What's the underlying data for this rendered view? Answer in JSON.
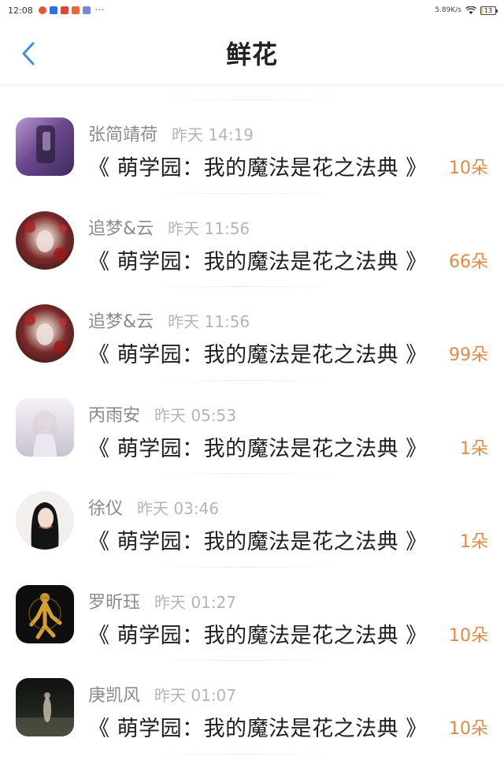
{
  "status_bar": {
    "time": "12:08",
    "dots": "···",
    "net_speed": "5.89K/s",
    "battery": "13",
    "notification_colors": [
      "#e8572f",
      "#2f6fe8",
      "#e2403a",
      "#e86a3a",
      "#7a88d8"
    ]
  },
  "header": {
    "title": "鲜花",
    "back_icon": "chevron-left-icon",
    "accent_color": "#3d8fe0"
  },
  "items": [
    {
      "name": "张简靖荷",
      "time": "昨天 14:19",
      "book": "《 萌学园：我的魔法是花之法典 》",
      "count": "10朵",
      "avatar_shape": "square",
      "avatar_bg": "#7a5a9e"
    },
    {
      "name": "追梦&云",
      "time": "昨天 11:56",
      "book": "《 萌学园：我的魔法是花之法典 》",
      "count": "66朵",
      "avatar_shape": "round",
      "avatar_bg": "#5a2a2a"
    },
    {
      "name": "追梦&云",
      "time": "昨天 11:56",
      "book": "《 萌学园：我的魔法是花之法典 》",
      "count": "99朵",
      "avatar_shape": "round",
      "avatar_bg": "#5a2a2a"
    },
    {
      "name": "丙雨安",
      "time": "昨天 05:53",
      "book": "《 萌学园：我的魔法是花之法典 》",
      "count": "1朵",
      "avatar_shape": "square",
      "avatar_bg": "#e8e4ea"
    },
    {
      "name": "徐仪",
      "time": "昨天 03:46",
      "book": "《 萌学园：我的魔法是花之法典 》",
      "count": "1朵",
      "avatar_shape": "round",
      "avatar_bg": "#f2f0ee"
    },
    {
      "name": "罗昕珏",
      "time": "昨天 01:27",
      "book": "《 萌学园：我的魔法是花之法典 》",
      "count": "10朵",
      "avatar_shape": "square",
      "avatar_bg": "#111111"
    },
    {
      "name": "庚凯风",
      "time": "昨天 01:07",
      "book": "《 萌学园：我的魔法是花之法典 》",
      "count": "10朵",
      "avatar_shape": "square",
      "avatar_bg": "#1e221e"
    }
  ]
}
